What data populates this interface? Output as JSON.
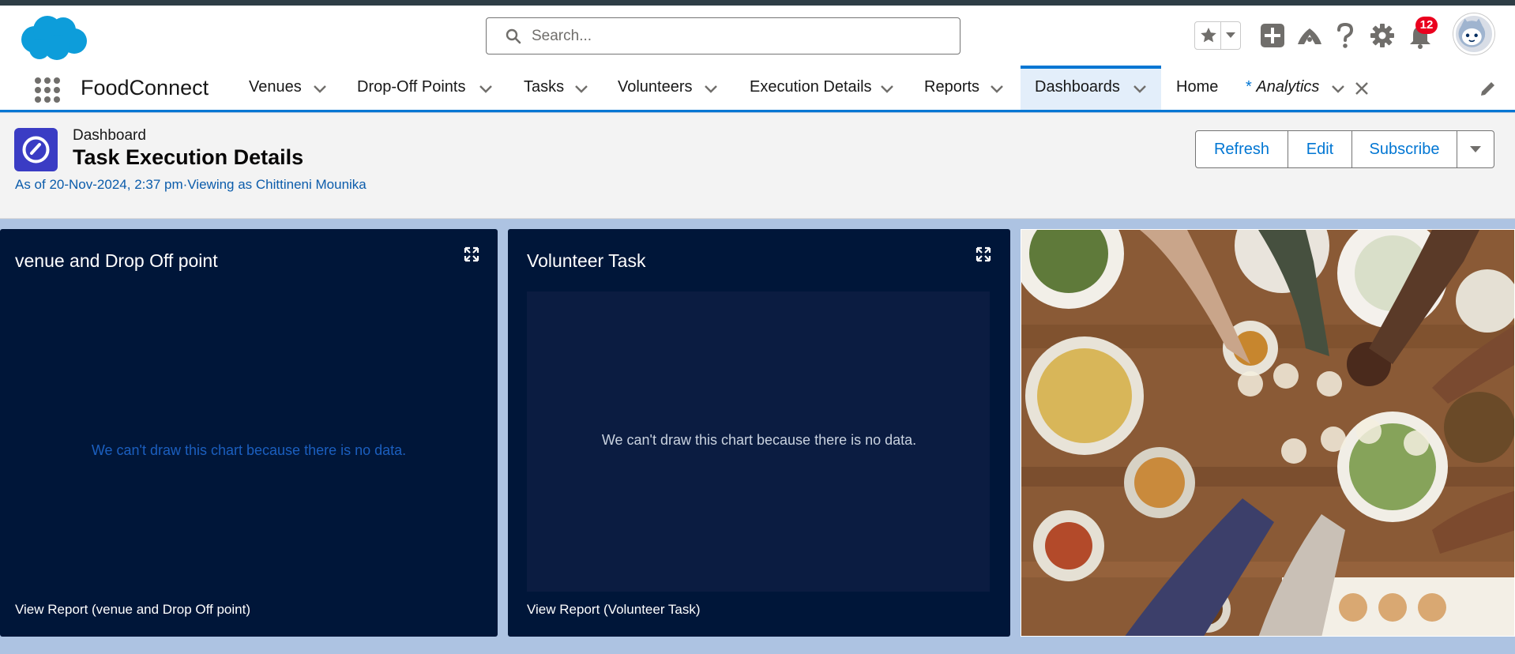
{
  "header": {
    "search_placeholder": "Search...",
    "notification_count": "12"
  },
  "nav": {
    "app_name": "FoodConnect",
    "items": [
      {
        "label": "Venues"
      },
      {
        "label": "Drop-Off Points"
      },
      {
        "label": "Tasks"
      },
      {
        "label": "Volunteers"
      },
      {
        "label": "Execution Details"
      },
      {
        "label": "Reports"
      },
      {
        "label": "Dashboards"
      },
      {
        "label": "Home"
      },
      {
        "label": "Analytics",
        "prefix": "*"
      }
    ]
  },
  "dashboard": {
    "type_label": "Dashboard",
    "title": "Task Execution Details",
    "meta": "As of 20-Nov-2024, 2:37 pm·Viewing as Chittineni Mounika",
    "buttons": {
      "refresh": "Refresh",
      "edit": "Edit",
      "subscribe": "Subscribe"
    }
  },
  "widgets": [
    {
      "title": "venue and Drop Off point",
      "no_data": "We can't draw this chart because there is no data.",
      "link": "View Report (venue and Drop Off point)"
    },
    {
      "title": "Volunteer Task",
      "no_data": "We can't draw this chart because there is no data.",
      "link": "View Report (Volunteer Task)"
    }
  ],
  "colors": {
    "brand": "#0176d3",
    "widget_bg": "#001639",
    "notification": "#ea001e",
    "dashboard_icon": "#3a3cc4"
  }
}
